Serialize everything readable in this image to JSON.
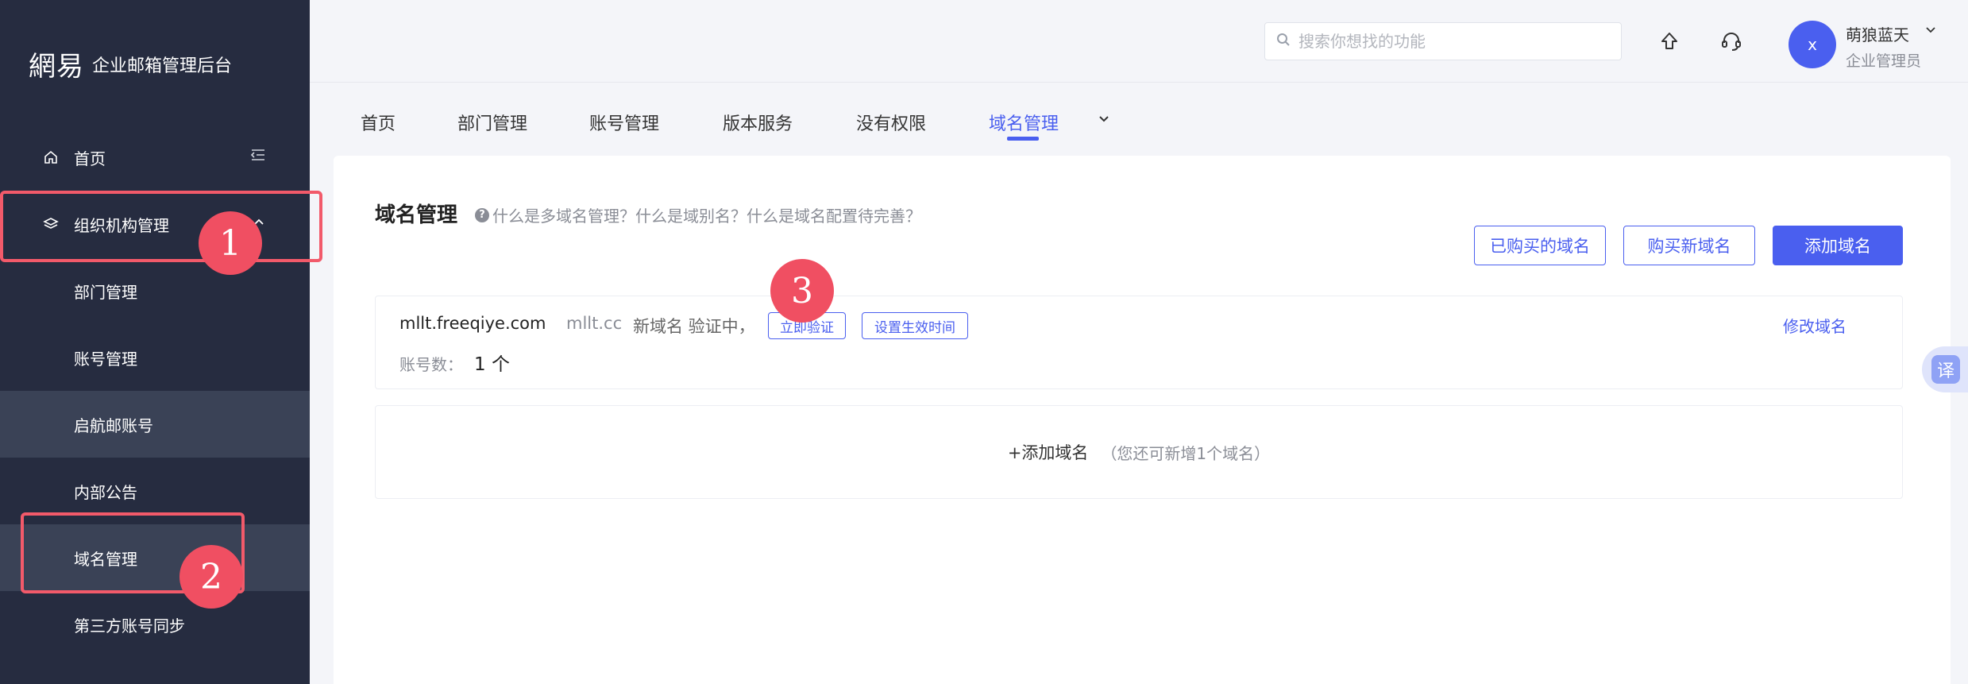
{
  "brand": {
    "logo": "網易",
    "title": "企业邮箱管理后台"
  },
  "sidebar": {
    "items": [
      {
        "label": "首页",
        "icon": "home-icon"
      },
      {
        "label": "组织机构管理",
        "icon": "layers-icon"
      },
      {
        "label": "部门管理"
      },
      {
        "label": "账号管理"
      },
      {
        "label": "启航邮账号"
      },
      {
        "label": "内部公告"
      },
      {
        "label": "域名管理"
      },
      {
        "label": "第三方账号同步"
      }
    ]
  },
  "header": {
    "search_placeholder": "搜索你想找的功能",
    "avatar_letter": "x",
    "user_name": "萌狼蓝天",
    "user_role": "企业管理员"
  },
  "tabs": [
    "首页",
    "部门管理",
    "账号管理",
    "版本服务",
    "没有权限",
    "域名管理"
  ],
  "main": {
    "title": "域名管理",
    "help_text": "什么是多域名管理？什么是域别名？什么是域名配置待完善？",
    "buttons": {
      "purchased": "已购买的域名",
      "buy_new": "购买新域名",
      "add": "添加域名"
    },
    "domain": {
      "name": "mllt.freeqiye.com",
      "alias": "mllt.cc",
      "status": "新域名 验证中，",
      "verify_btn": "立即验证",
      "set_time_btn": "设置生效时间",
      "account_label": "账号数：",
      "account_count": "1 个",
      "modify": "修改域名"
    },
    "add_domain": {
      "label": "+添加域名",
      "hint": "（您还可新增1个域名）"
    }
  },
  "annotations": [
    "1",
    "2",
    "3"
  ],
  "translate_label": "译",
  "colors": {
    "accent": "#4a5fef",
    "sidebar_bg": "#262c40",
    "annotation": "#f04f62"
  }
}
